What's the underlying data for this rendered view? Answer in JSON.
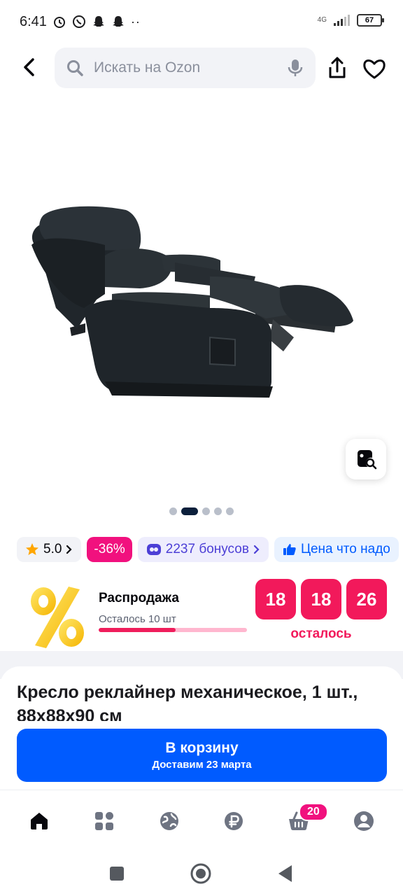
{
  "status_bar": {
    "time": "6:41",
    "network": "4G",
    "battery": "67"
  },
  "search": {
    "placeholder": "Искать на Ozon"
  },
  "gallery": {
    "dots_total": 5,
    "active_dot": 2
  },
  "chips": {
    "rating": "5.0",
    "discount": "-36%",
    "bonus": "2237 бонусов",
    "price_label": "Цена что надо"
  },
  "sale": {
    "title": "Распродажа",
    "remaining": "Осталось 10 шт",
    "remaining_fraction": 0.52,
    "timer": [
      "18",
      "18",
      "26"
    ],
    "timer_label": "осталось"
  },
  "product": {
    "title": "Кресло реклайнер механическое, 1 шт., 88х88х90 см"
  },
  "cart": {
    "label": "В корзину",
    "delivery": "Доставим 23 марта"
  },
  "nav": {
    "cart_badge": "20"
  },
  "colors": {
    "primary": "#005bff",
    "accent": "#f1117e",
    "timer": "#f2195b"
  }
}
